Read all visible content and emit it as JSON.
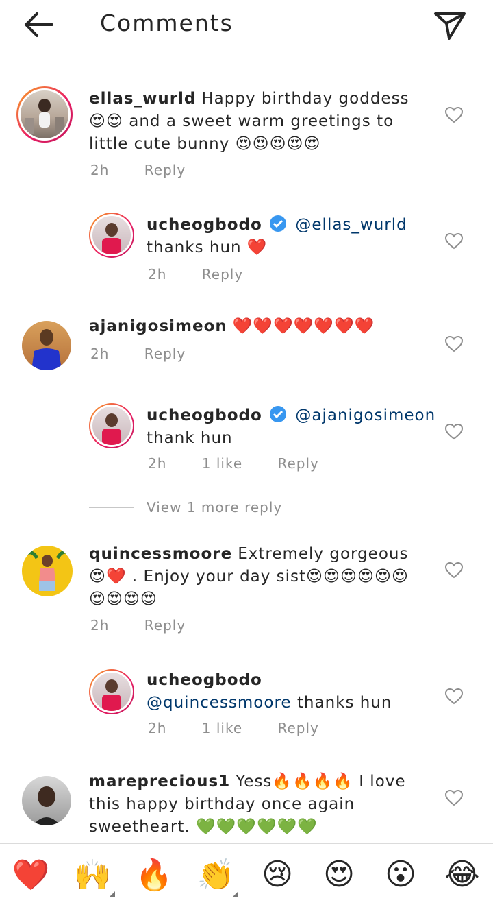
{
  "header": {
    "title": "Comments"
  },
  "comments": [
    {
      "user": "ellas_wurld",
      "text": "Happy birthday goddess 😍😍 and a sweet warm greetings to little cute bunny 😍😍😍😍😍",
      "time": "2h",
      "reply": "Reply"
    },
    {
      "user": "ucheogbodo",
      "mention": "@ellas_wurld",
      "text": "thanks hun ❤️",
      "time": "2h",
      "reply": "Reply"
    },
    {
      "user": "ajanigosimeon",
      "text": "❤️❤️❤️❤️❤️❤️❤️",
      "time": "2h",
      "reply": "Reply"
    },
    {
      "user": "ucheogbodo",
      "mention": "@ajanigosimeon",
      "text": "thank hun",
      "time": "2h",
      "likes": "1 like",
      "reply": "Reply"
    },
    {
      "user": "quincessmoore",
      "text": "Extremely gorgeous😍❤️ . Enjoy your day sist😍😍😍😍😍😍😍😍😍😍",
      "time": "2h",
      "reply": "Reply"
    },
    {
      "user": "ucheogbodo",
      "mention": "@quincessmoore",
      "text": "thanks hun",
      "time": "2h",
      "likes": "1 like",
      "reply": "Reply"
    },
    {
      "user": "mareprecious1",
      "text": "Yess🔥🔥🔥🔥 I love this happy birthday once again sweetheart. 💚💚💚💚💚💚"
    }
  ],
  "view_more": "View 1 more reply",
  "emoji_bar": [
    "❤️",
    "🙌",
    "🔥",
    "👏",
    "😢",
    "😍",
    "😮",
    "😂"
  ],
  "colors": {
    "mention": "#00376b",
    "meta": "#8e8e8e",
    "verified": "#3897f0"
  }
}
